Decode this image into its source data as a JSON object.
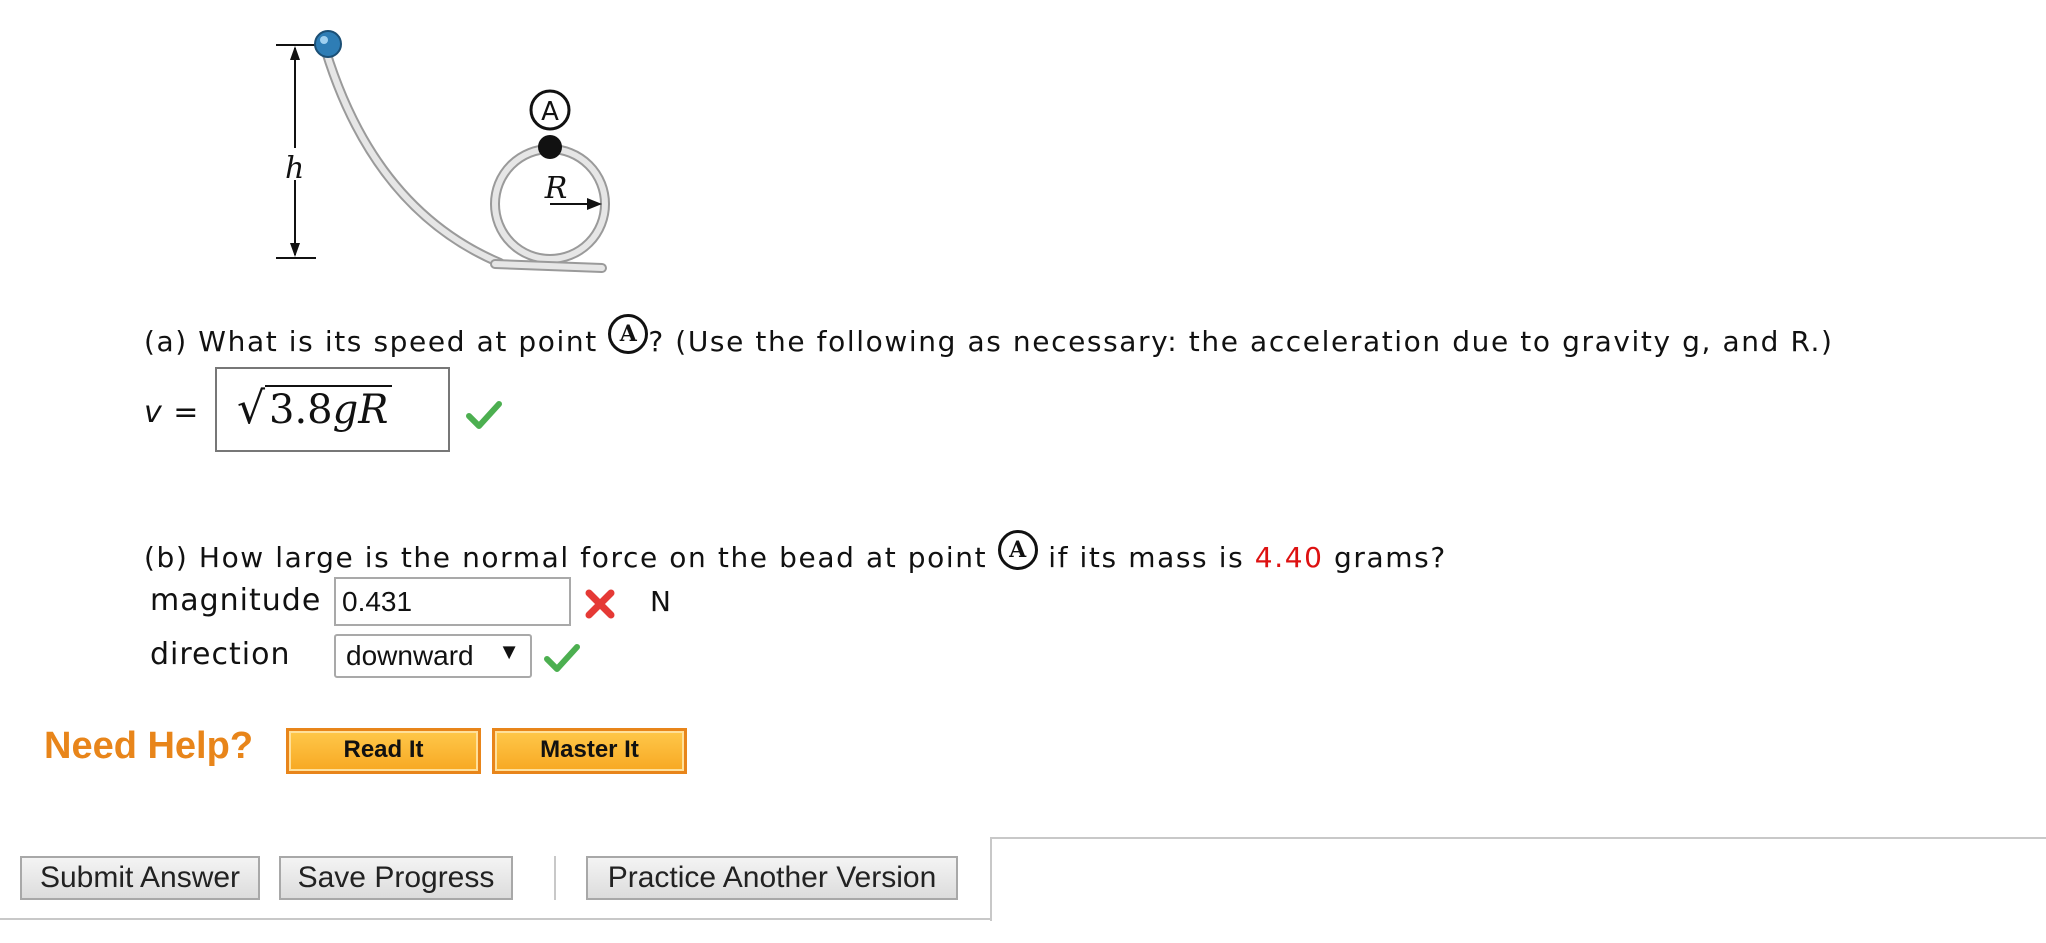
{
  "figure": {
    "height_label": "h",
    "radius_label": "R",
    "point_label": "A"
  },
  "part_a": {
    "prefix": "(a) What is its speed at point ",
    "point": "A",
    "suffix": "? (Use the following as necessary: the acceleration due to gravity g, and R.)",
    "var_label": "v =",
    "answer": {
      "sqrt_symbol": "√",
      "coefficient": "3.8",
      "var1": "g",
      "var2": "R"
    },
    "status_icon": "check-icon"
  },
  "part_b": {
    "prefix": "(b) How large is the normal force on the bead at point ",
    "point": "A",
    "middle": " if its mass is ",
    "mass": "4.40",
    "suffix": " grams?",
    "magnitude_label": "magnitude",
    "magnitude_value": "0.431",
    "magnitude_status_icon": "x-icon",
    "unit": "N",
    "direction_label": "direction",
    "direction_value": "downward",
    "direction_arrow": "▼",
    "direction_status_icon": "check-icon"
  },
  "help": {
    "title": "Need Help?",
    "read_it": "Read It",
    "master_it": "Master It"
  },
  "actions": {
    "submit": "Submit Answer",
    "save": "Save Progress",
    "practice": "Practice Another Version"
  },
  "colors": {
    "correct": "#4caf50",
    "incorrect": "#e53935",
    "help_orange": "#e8851a",
    "mass_red": "#dd1111"
  }
}
